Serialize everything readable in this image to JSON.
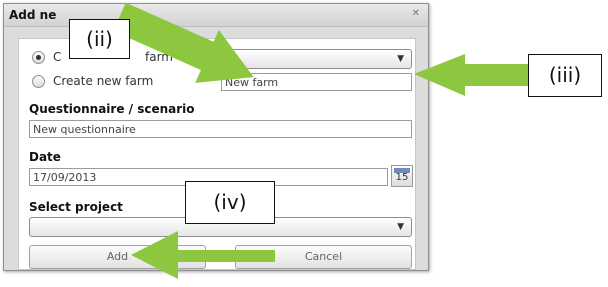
{
  "dialog": {
    "title": "Add ne",
    "close_icon": "close-icon"
  },
  "farm": {
    "existing_label_start": "C",
    "existing_label_end": "farm",
    "new_label": "Create new farm",
    "new_farm_value": "New farm"
  },
  "questionnaire": {
    "label": "Questionnaire / scenario",
    "value": "New questionnaire"
  },
  "date": {
    "label": "Date",
    "value": "17/09/2013",
    "calendar_day": "15"
  },
  "project": {
    "label": "Select project",
    "value": ""
  },
  "buttons": {
    "add": "Add",
    "cancel": "Cancel"
  },
  "callouts": {
    "ii": "(ii)",
    "iii": "(iii)",
    "iv": "(iv)"
  },
  "colors": {
    "arrow": "#8DC63F"
  }
}
